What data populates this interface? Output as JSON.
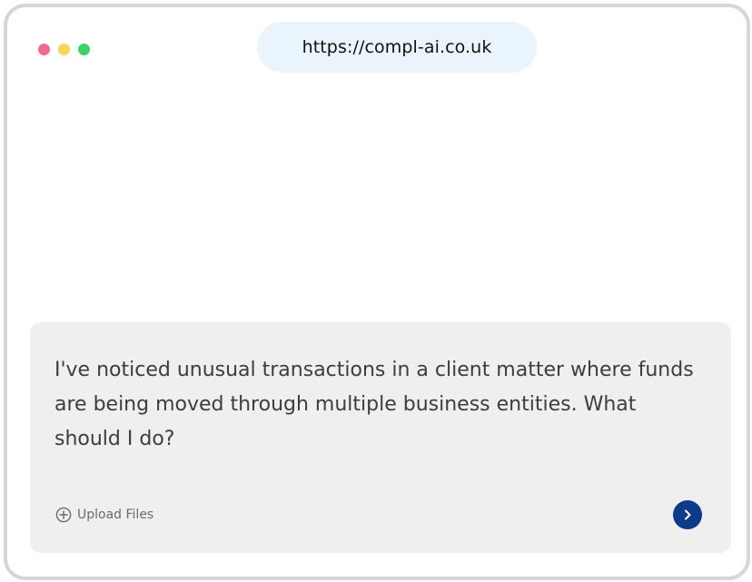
{
  "window": {
    "controls": [
      {
        "name": "close",
        "color": "#f06b8c"
      },
      {
        "name": "minimize",
        "color": "#f7d55a"
      },
      {
        "name": "maximize",
        "color": "#3ed26a"
      }
    ]
  },
  "address_bar": {
    "url": "https://compl-ai.co.uk"
  },
  "chat": {
    "message": "I've noticed unusual transactions in a client matter where funds are being moved through multiple business entities. What should I do?",
    "upload_label": "Upload Files",
    "upload_icon": "plus-circle-icon",
    "send_icon": "chevron-right-icon",
    "send_color": "#0e3a8a"
  }
}
